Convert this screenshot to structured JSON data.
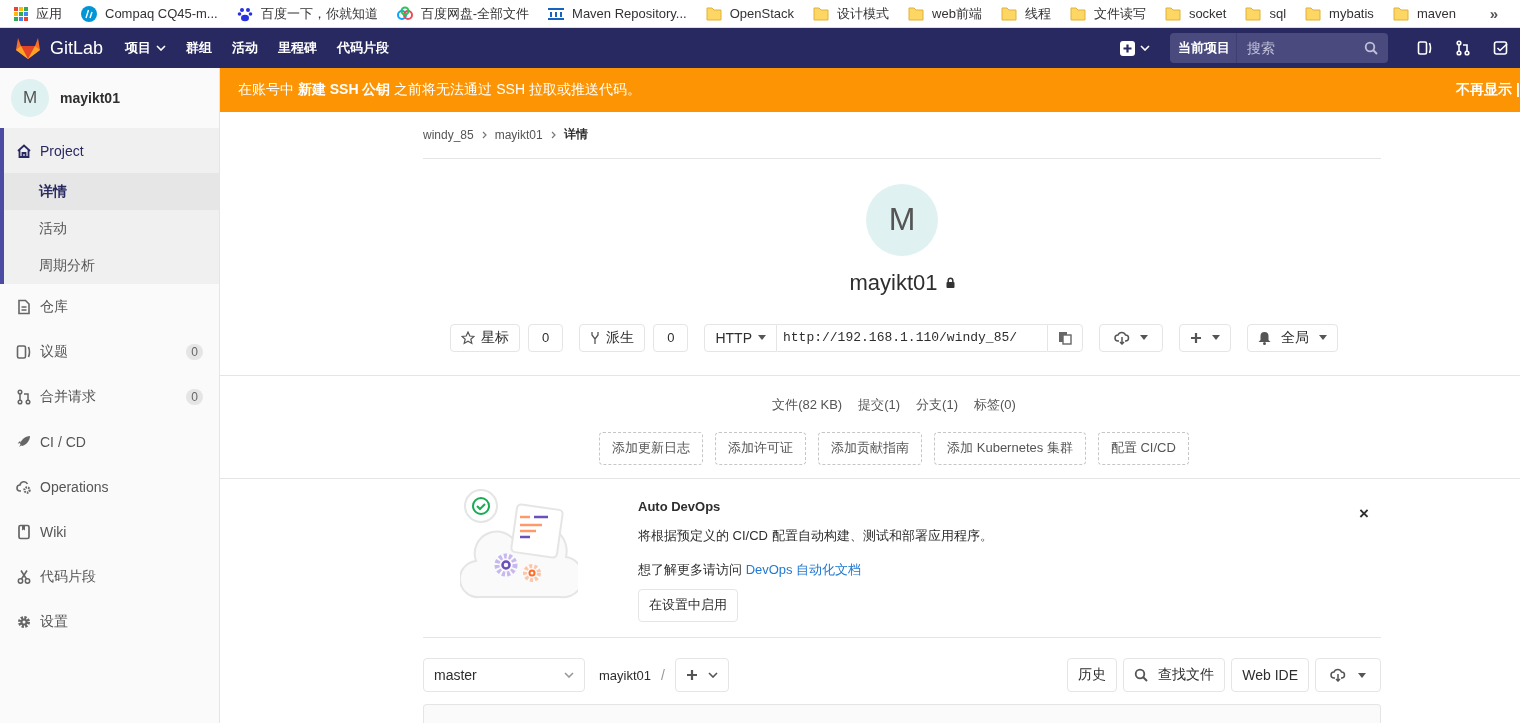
{
  "bookmarks": {
    "items": [
      {
        "label": "应用",
        "kind": "apps"
      },
      {
        "label": "Compaq CQ45-m...",
        "kind": "hp"
      },
      {
        "label": "百度一下，你就知道",
        "kind": "paw"
      },
      {
        "label": "百度网盘-全部文件",
        "kind": "cloud"
      },
      {
        "label": "Maven Repository...",
        "kind": "mvn"
      },
      {
        "label": "OpenStack",
        "kind": "folder"
      },
      {
        "label": "设计模式",
        "kind": "folder"
      },
      {
        "label": "web前端",
        "kind": "folder"
      },
      {
        "label": "线程",
        "kind": "folder"
      },
      {
        "label": "文件读写",
        "kind": "folder"
      },
      {
        "label": "socket",
        "kind": "folder"
      },
      {
        "label": "sql",
        "kind": "folder"
      },
      {
        "label": "mybatis",
        "kind": "folder"
      },
      {
        "label": "maven",
        "kind": "folder"
      }
    ],
    "overflow": "»"
  },
  "navbar": {
    "brand": "GitLab",
    "items": [
      {
        "label": "项目",
        "dropdown": true
      },
      {
        "label": "群组",
        "dropdown": false
      },
      {
        "label": "活动",
        "dropdown": false
      },
      {
        "label": "里程碑",
        "dropdown": false
      },
      {
        "label": "代码片段",
        "dropdown": false
      }
    ],
    "scope": "当前项目",
    "search_placeholder": "搜索"
  },
  "sidebar": {
    "avatar": "M",
    "project_name": "mayikt01",
    "items": [
      {
        "label": "Project",
        "kind": "home",
        "selected": true,
        "children": [
          {
            "label": "详情",
            "selected": true
          },
          {
            "label": "活动",
            "selected": false
          },
          {
            "label": "周期分析",
            "selected": false
          }
        ]
      },
      {
        "label": "仓库",
        "kind": "doc",
        "selected": false
      },
      {
        "label": "议题",
        "kind": "issues",
        "selected": false,
        "count": "0"
      },
      {
        "label": "合并请求",
        "kind": "merge",
        "selected": false,
        "count": "0"
      },
      {
        "label": "CI / CD",
        "kind": "rocket",
        "selected": false
      },
      {
        "label": "Operations",
        "kind": "cloudgear",
        "selected": false
      },
      {
        "label": "Wiki",
        "kind": "book",
        "selected": false
      },
      {
        "label": "代码片段",
        "kind": "scissors",
        "selected": false
      },
      {
        "label": "设置",
        "kind": "gear",
        "selected": false
      }
    ]
  },
  "alert": {
    "text": "在账号中 **新建 SSH 公钥** 之前将无法通过 SSH 拉取或推送代码。",
    "action": "不再显示 |"
  },
  "breadcrumb": [
    "windy_85",
    "mayikt01",
    "详情"
  ],
  "project": {
    "avatar": "M",
    "name": "mayikt01",
    "private": true
  },
  "actions": {
    "star": {
      "label": "星标",
      "count": "0"
    },
    "fork": {
      "label": "派生",
      "count": "0"
    },
    "protocol": "HTTP",
    "clone_url": "http://192.168.1.110/windy_85/",
    "notification": "全局"
  },
  "stats": [
    "文件(82 KB)",
    "提交(1)",
    "分支(1)",
    "标签(0)"
  ],
  "quick_add": [
    "添加更新日志",
    "添加许可证",
    "添加贡献指南",
    "添加 Kubernetes 集群",
    "配置 CI/CD"
  ],
  "auto_devops": {
    "title": "Auto DevOps",
    "description": "将根据预定义的 CI/CD 配置自动构建、测试和部署应用程序。",
    "learn_more": "想了解更多请访问",
    "link": "DevOps 自动化文档",
    "button": "在设置中启用",
    "close": "×"
  },
  "tree_controls": {
    "branch": "master",
    "path": "mayikt01",
    "separator": "/",
    "buttons": [
      "历史",
      "查找文件",
      "Web IDE"
    ]
  }
}
